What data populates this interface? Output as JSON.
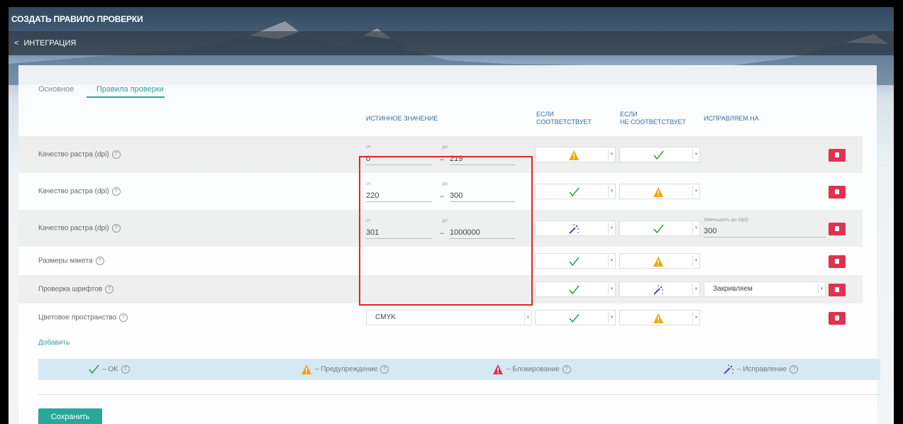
{
  "window": {
    "title": "СОЗДАТЬ ПРАВИЛО ПРОВЕРКИ"
  },
  "breadcrumb": {
    "back_label": "ИНТЕГРАЦИЯ"
  },
  "tabs": [
    {
      "label": "Основное",
      "active": false
    },
    {
      "label": "Правила проверки",
      "active": true
    }
  ],
  "columns": {
    "true_value": "ИСТИННОЕ ЗНАЧЕНИЕ",
    "if_match": [
      "ЕСЛИ",
      "СООТВЕТСТВУЕТ"
    ],
    "if_not_match": [
      "ЕСЛИ",
      "НЕ СООТВЕТСТВУЕТ"
    ],
    "fix_to": "ИСПРАВЛЯЕМ НА"
  },
  "range_labels": {
    "from": "от",
    "to": "до"
  },
  "rows": [
    {
      "label": "Качество растра (dpi)",
      "from": "0",
      "to": "219",
      "match_icon": "warning-icon",
      "nomatch_icon": "check-icon"
    },
    {
      "label": "Качество растра (dpi)",
      "from": "220",
      "to": "300",
      "match_icon": "check-icon",
      "nomatch_icon": "warning-icon"
    },
    {
      "label": "Качество растра (dpi)",
      "from": "301",
      "to": "1000000",
      "match_icon": "magic-wand-icon",
      "nomatch_icon": "check-icon",
      "fix_label": "Уменьшить до (dpi)",
      "fix_value": "300"
    },
    {
      "label": "Размеры макета",
      "match_icon": "check-icon",
      "nomatch_icon": "warning-icon"
    },
    {
      "label": "Проверка шрифтов",
      "match_icon": "check-icon",
      "nomatch_icon": "magic-wand-icon",
      "fix_select": "Закривляем"
    },
    {
      "label": "Цветовое пространство",
      "value_select": "CMYK",
      "match_icon": "check-icon",
      "nomatch_icon": "warning-icon"
    }
  ],
  "add_label": "Добавить",
  "legend": [
    {
      "icon": "check-icon",
      "label": "– OK"
    },
    {
      "icon": "warning-icon",
      "label": "– Предупреждение"
    },
    {
      "icon": "block-icon",
      "label": "– Блокирование"
    },
    {
      "icon": "magic-wand-icon",
      "label": "– Исправление"
    }
  ],
  "save_label": "Сохранить",
  "colors": {
    "accent": "#2aa79b",
    "delete": "#e0334f",
    "warning": "#f0a500",
    "block": "#e0334f",
    "highlight": "#e8202a"
  }
}
